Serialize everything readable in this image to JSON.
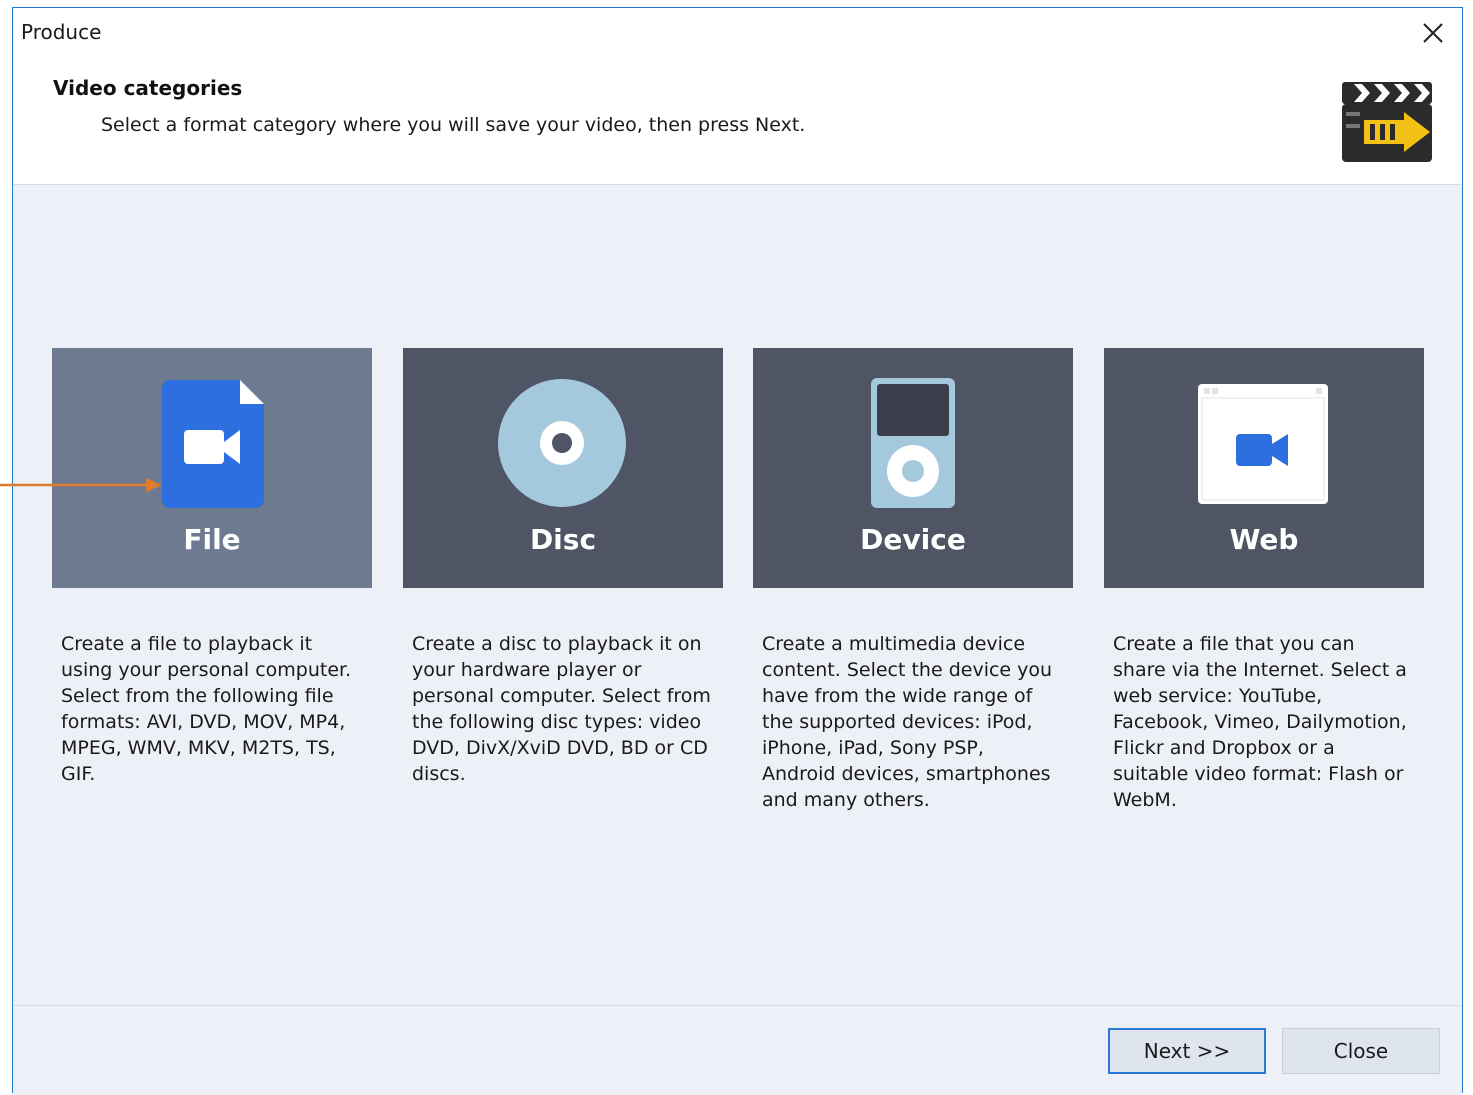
{
  "window": {
    "title": "Produce"
  },
  "header": {
    "title": "Video categories",
    "subtitle": "Select a format category where you will save your video, then press Next."
  },
  "categories": [
    {
      "label": "File",
      "selected": true,
      "description": "Create a file to playback it using your personal computer. Select from the following file formats: AVI, DVD, MOV, MP4, MPEG, WMV, MKV, M2TS, TS, GIF."
    },
    {
      "label": "Disc",
      "selected": false,
      "description": "Create a disc to playback it on your hardware player or personal computer. Select from the following disc types: video DVD, DivX/XviD DVD, BD or CD discs."
    },
    {
      "label": "Device",
      "selected": false,
      "description": "Create a multimedia device content. Select the device you have from the wide range of the supported devices: iPod, iPhone, iPad, Sony PSP, Android devices, smartphones and many others."
    },
    {
      "label": "Web",
      "selected": false,
      "description": "Create a file that you can share via the Internet. Select a web service: YouTube, Facebook, Vimeo, Dailymotion, Flickr and Dropbox or a suitable video format: Flash or WebM."
    }
  ],
  "footer": {
    "next_label": "Next >>",
    "close_label": "Close"
  },
  "colors": {
    "accent": "#2a79d6",
    "card": "#4f5565",
    "card_selected": "#6e7a90",
    "annotation_arrow": "#e07b2e"
  }
}
